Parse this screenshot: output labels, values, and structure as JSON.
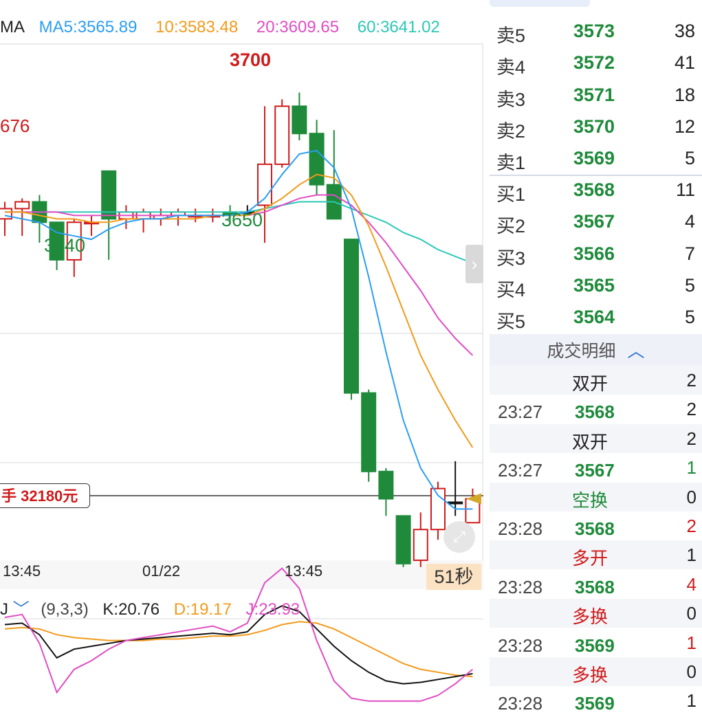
{
  "ma_legend": {
    "label": "MA",
    "ma5": "MA5:3565.89",
    "ma10": "10:3583.48",
    "ma20": "20:3609.65",
    "ma60": "60:3641.02",
    "colors": {
      "ma5": "#2a9df4",
      "ma10": "#f29a1b",
      "ma20": "#e04cc4",
      "ma60": "#2cc7b7"
    }
  },
  "annotations": {
    "high_left": "676",
    "high": "3700",
    "low_a": "3640",
    "low_b": "3650"
  },
  "position_tag": "手 32180元",
  "time_axis": [
    "13:45",
    "01/22",
    "13:45"
  ],
  "countdown": "51秒",
  "kdj": {
    "indicator_label": "J",
    "params": "(9,3,3)",
    "k": "K:20.76",
    "d": "D:19.17",
    "j": "J:23.93"
  },
  "order_book": {
    "asks": [
      {
        "label": "卖5",
        "price": "3573",
        "vol": "38"
      },
      {
        "label": "卖4",
        "price": "3572",
        "vol": "41"
      },
      {
        "label": "卖3",
        "price": "3571",
        "vol": "18"
      },
      {
        "label": "卖2",
        "price": "3570",
        "vol": "12"
      },
      {
        "label": "卖1",
        "price": "3569",
        "vol": "5"
      }
    ],
    "bids": [
      {
        "label": "买1",
        "price": "3568",
        "vol": "11"
      },
      {
        "label": "买2",
        "price": "3567",
        "vol": "4"
      },
      {
        "label": "买3",
        "price": "3566",
        "vol": "7"
      },
      {
        "label": "买4",
        "price": "3565",
        "vol": "5"
      },
      {
        "label": "买5",
        "price": "3564",
        "vol": "5"
      }
    ]
  },
  "trade_detail": {
    "header": "成交明细",
    "rows": [
      {
        "time": "",
        "price": "",
        "kind": "双开",
        "vol": "2",
        "kind_color": "#222",
        "vol_color": "#222"
      },
      {
        "time": "23:27",
        "price": "3568",
        "kind": "",
        "vol": "2",
        "kind_color": "#222",
        "vol_color": "#222"
      },
      {
        "time": "",
        "price": "",
        "kind": "双开",
        "vol": "2",
        "kind_color": "#222",
        "vol_color": "#222"
      },
      {
        "time": "23:27",
        "price": "3567",
        "kind": "",
        "vol": "1",
        "kind_color": "#222",
        "vol_color": "#1e8a3a"
      },
      {
        "time": "",
        "price": "",
        "kind": "空换",
        "vol": "0",
        "kind_color": "#1e8a3a",
        "vol_color": "#222"
      },
      {
        "time": "23:28",
        "price": "3568",
        "kind": "",
        "vol": "2",
        "kind_color": "#222",
        "vol_color": "#d01a1a"
      },
      {
        "time": "",
        "price": "",
        "kind": "多开",
        "vol": "1",
        "kind_color": "#d01a1a",
        "vol_color": "#222"
      },
      {
        "time": "23:28",
        "price": "3568",
        "kind": "",
        "vol": "4",
        "kind_color": "#222",
        "vol_color": "#d01a1a"
      },
      {
        "time": "",
        "price": "",
        "kind": "多换",
        "vol": "0",
        "kind_color": "#d01a1a",
        "vol_color": "#222"
      },
      {
        "time": "23:28",
        "price": "3569",
        "kind": "",
        "vol": "1",
        "kind_color": "#222",
        "vol_color": "#d01a1a"
      },
      {
        "time": "",
        "price": "",
        "kind": "多换",
        "vol": "0",
        "kind_color": "#d01a1a",
        "vol_color": "#222"
      },
      {
        "time": "23:28",
        "price": "3569",
        "kind": "",
        "vol": "1",
        "kind_color": "#222",
        "vol_color": "#222"
      }
    ]
  },
  "chart_data": {
    "type": "candlestick",
    "ylim": [
      3560,
      3705
    ],
    "candles": [
      {
        "o": 3657,
        "h": 3662,
        "l": 3652,
        "c": 3660,
        "dir": "up"
      },
      {
        "o": 3660,
        "h": 3663,
        "l": 3652,
        "c": 3662,
        "dir": "up"
      },
      {
        "o": 3662,
        "h": 3664,
        "l": 3650,
        "c": 3656,
        "dir": "down"
      },
      {
        "o": 3656,
        "h": 3656,
        "l": 3642,
        "c": 3645,
        "dir": "down"
      },
      {
        "o": 3645,
        "h": 3657,
        "l": 3640,
        "c": 3656,
        "dir": "up"
      },
      {
        "o": 3656,
        "h": 3658,
        "l": 3652,
        "c": 3656,
        "dir": "up"
      },
      {
        "o": 3671,
        "h": 3671,
        "l": 3645,
        "c": 3657,
        "dir": "down"
      },
      {
        "o": 3657,
        "h": 3661,
        "l": 3654,
        "c": 3659,
        "dir": "up"
      },
      {
        "o": 3657,
        "h": 3660,
        "l": 3653,
        "c": 3659,
        "dir": "up"
      },
      {
        "o": 3657,
        "h": 3660,
        "l": 3655,
        "c": 3658,
        "dir": "up"
      },
      {
        "o": 3658,
        "h": 3660,
        "l": 3655,
        "c": 3659,
        "dir": "up"
      },
      {
        "o": 3658,
        "h": 3660,
        "l": 3656,
        "c": 3658,
        "dir": "up"
      },
      {
        "o": 3658,
        "h": 3660,
        "l": 3656,
        "c": 3658,
        "dir": "up"
      },
      {
        "o": 3658,
        "h": 3661,
        "l": 3656,
        "c": 3659,
        "dir": "down"
      },
      {
        "o": 3659,
        "h": 3661,
        "l": 3658,
        "c": 3659,
        "dir": "flat"
      },
      {
        "o": 3661,
        "h": 3690,
        "l": 3650,
        "c": 3673,
        "dir": "up"
      },
      {
        "o": 3673,
        "h": 3692,
        "l": 3672,
        "c": 3690,
        "dir": "up"
      },
      {
        "o": 3690,
        "h": 3694,
        "l": 3680,
        "c": 3682,
        "dir": "down"
      },
      {
        "o": 3682,
        "h": 3686,
        "l": 3664,
        "c": 3667,
        "dir": "down"
      },
      {
        "o": 3667,
        "h": 3683,
        "l": 3658,
        "c": 3657,
        "dir": "down"
      },
      {
        "o": 3651,
        "h": 3651,
        "l": 3604,
        "c": 3606,
        "dir": "down"
      },
      {
        "o": 3606,
        "h": 3607,
        "l": 3580,
        "c": 3583,
        "dir": "down"
      },
      {
        "o": 3583,
        "h": 3584,
        "l": 3570,
        "c": 3575,
        "dir": "down"
      },
      {
        "o": 3570,
        "h": 3570,
        "l": 3555,
        "c": 3556,
        "dir": "down"
      },
      {
        "o": 3557,
        "h": 3571,
        "l": 3555,
        "c": 3566,
        "dir": "up"
      },
      {
        "o": 3566,
        "h": 3580,
        "l": 3563,
        "c": 3578,
        "dir": "up"
      },
      {
        "o": 3574,
        "h": 3586,
        "l": 3570,
        "c": 3574,
        "dir": "flat"
      },
      {
        "o": 3568,
        "h": 3578,
        "l": 3568,
        "c": 3575,
        "dir": "up"
      }
    ],
    "ma5": [
      3658,
      3657,
      3656,
      3653,
      3652,
      3651,
      3654,
      3656,
      3657,
      3657,
      3658,
      3658,
      3658,
      3658,
      3659,
      3663,
      3670,
      3676,
      3677,
      3672,
      3660,
      3640,
      3618,
      3598,
      3584,
      3576,
      3572,
      3572
    ],
    "ma10": [
      3659,
      3659,
      3658,
      3657,
      3657,
      3656,
      3656,
      3657,
      3657,
      3657,
      3657,
      3657,
      3658,
      3658,
      3658,
      3660,
      3663,
      3667,
      3670,
      3669,
      3664,
      3655,
      3643,
      3630,
      3617,
      3607,
      3598,
      3590
    ],
    "ma20": [
      3659,
      3659,
      3659,
      3659,
      3658,
      3658,
      3658,
      3658,
      3658,
      3658,
      3658,
      3658,
      3658,
      3658,
      3658,
      3659,
      3661,
      3663,
      3664,
      3664,
      3661,
      3656,
      3650,
      3643,
      3636,
      3628,
      3622,
      3617
    ],
    "ma60": [
      3659,
      3659,
      3659,
      3659,
      3659,
      3659,
      3659,
      3659,
      3659,
      3659,
      3659,
      3659,
      3659,
      3659,
      3659,
      3660,
      3661,
      3662,
      3662,
      3662,
      3660,
      3658,
      3656,
      3653,
      3651,
      3648,
      3646,
      3644
    ],
    "kdj_k": [
      55,
      56,
      48,
      32,
      38,
      40,
      42,
      44,
      45,
      46,
      47,
      48,
      49,
      48,
      50,
      62,
      68,
      64,
      52,
      40,
      30,
      22,
      16,
      14,
      15,
      17,
      19,
      21
    ],
    "kdj_d": [
      52,
      53,
      52,
      48,
      46,
      45,
      44,
      44,
      44,
      45,
      45,
      46,
      47,
      47,
      48,
      51,
      55,
      57,
      56,
      52,
      46,
      40,
      34,
      28,
      24,
      22,
      20,
      19
    ],
    "kdj_j": [
      60,
      62,
      42,
      8,
      24,
      30,
      38,
      44,
      46,
      48,
      50,
      52,
      54,
      50,
      56,
      84,
      94,
      80,
      44,
      16,
      4,
      2,
      2,
      2,
      2,
      6,
      14,
      24
    ]
  }
}
